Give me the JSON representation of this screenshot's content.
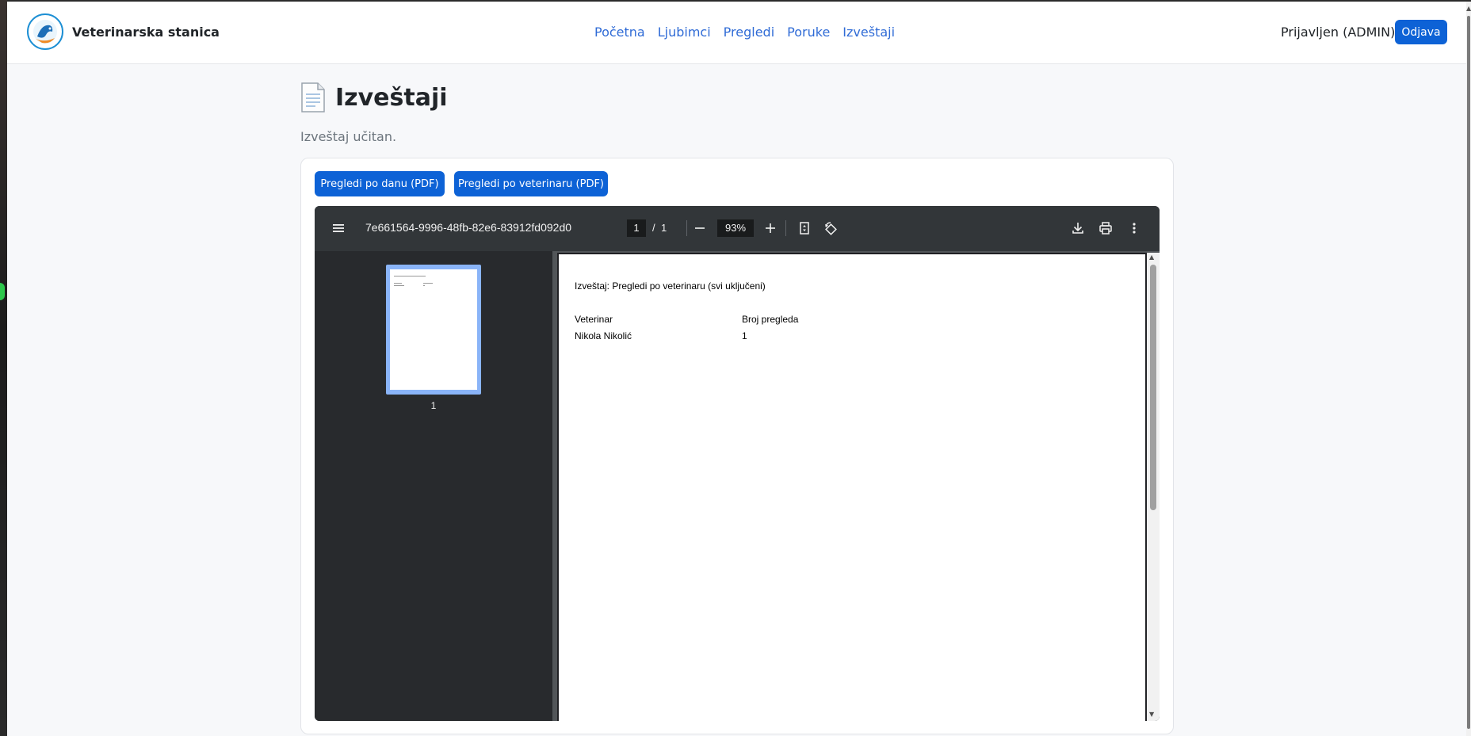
{
  "navbar": {
    "brand_name": "Veterinarska stanica",
    "links": [
      "Početna",
      "Ljubimci",
      "Pregledi",
      "Poruke",
      "Izveštaji"
    ],
    "user_label": "Prijavljen (ADMIN)",
    "logout_label": "Odjava"
  },
  "page": {
    "title": "Izveštaji",
    "status": "Izveštaj učitan."
  },
  "actions": {
    "by_day_label": "Pregledi po danu (PDF)",
    "by_vet_label": "Pregledi po veterinaru (PDF)"
  },
  "viewer": {
    "document_name": "7e661564-9996-48fb-82e6-83912fd092d0",
    "current_page": "1",
    "page_separator": "/",
    "total_pages": "1",
    "zoom": "93%",
    "thumbnail_label": "1",
    "icons": [
      "menu-icon",
      "zoom-out-icon",
      "zoom-in-icon",
      "fit-page-icon",
      "rotate-icon",
      "download-icon",
      "print-icon",
      "more-icon"
    ]
  },
  "report": {
    "title": "Izveštaj: Pregledi po veterinaru (svi uključeni)",
    "columns": [
      "Veterinar",
      "Broj pregleda"
    ],
    "rows": [
      [
        "Nikola Nikolić",
        "1"
      ]
    ]
  },
  "colors": {
    "primary": "#0d62d6",
    "link": "#2f6bd6",
    "viewer_toolbar": "#323639",
    "viewer_sidebar": "#282a2d"
  }
}
